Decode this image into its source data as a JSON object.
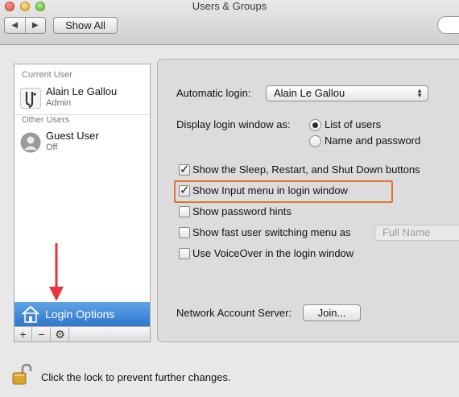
{
  "window": {
    "title": "Users & Groups"
  },
  "toolbar": {
    "back_glyph": "◀",
    "forward_glyph": "▶",
    "show_all_label": "Show All"
  },
  "sidebar": {
    "current_user_header": "Current User",
    "current_user": {
      "name": "Alain Le Gallou",
      "role": "Admin"
    },
    "other_users_header": "Other Users",
    "other_users": [
      {
        "name": "Guest User",
        "status": "Off"
      }
    ],
    "login_options_label": "Login Options",
    "toolbar": {
      "add": "+",
      "remove": "−",
      "action": "⚙"
    }
  },
  "login_options": {
    "automatic_login_label": "Automatic login:",
    "automatic_login_value": "Alain Le Gallou",
    "display_as_label": "Display login window as:",
    "display_options": [
      {
        "label": "List of users",
        "selected": true
      },
      {
        "label": "Name and password",
        "selected": false
      }
    ],
    "checkboxes": [
      {
        "label": "Show the Sleep, Restart, and Shut Down buttons",
        "checked": true
      },
      {
        "label": "Show Input menu in login window",
        "checked": true,
        "highlighted": true
      },
      {
        "label": "Show password hints",
        "checked": false
      },
      {
        "label": "Show fast user switching menu as",
        "checked": false
      },
      {
        "label": "Use VoiceOver in the login window",
        "checked": false
      }
    ],
    "fast_switch_value": "Full Name",
    "network_server_label": "Network Account Server:",
    "join_label": "Join..."
  },
  "footer": {
    "lock_text": "Click the lock to prevent further changes."
  },
  "colors": {
    "selection_blue": "#2f78cf",
    "highlight_orange": "#d9763a",
    "annotation_red": "#e8323c"
  }
}
